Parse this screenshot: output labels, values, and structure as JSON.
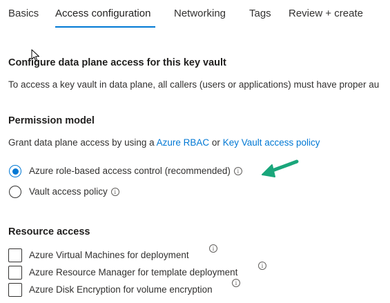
{
  "tabs": [
    {
      "label": "Basics"
    },
    {
      "label": "Access configuration"
    },
    {
      "label": "Networking"
    },
    {
      "label": "Tags"
    },
    {
      "label": "Review + create"
    }
  ],
  "active_tab": "Access configuration",
  "data_plane": {
    "heading": "Configure data plane access for this key vault",
    "description": "To access a key vault in data plane, all callers (users or applications) must have proper au"
  },
  "permission_model": {
    "heading": "Permission model",
    "grant_prefix": "Grant data plane access by using a ",
    "link_rbac": "Azure RBAC",
    "grant_or": " or ",
    "link_policy": "Key Vault access policy",
    "options": [
      {
        "label": "Azure role-based access control (recommended)",
        "checked": true
      },
      {
        "label": "Vault access policy",
        "checked": false
      }
    ]
  },
  "resource_access": {
    "heading": "Resource access",
    "items": [
      {
        "label": "Azure Virtual Machines for deployment",
        "checked": false
      },
      {
        "label": "Azure Resource Manager for template deployment",
        "checked": false
      },
      {
        "label": "Azure Disk Encryption for volume encryption",
        "checked": false
      }
    ]
  },
  "icons": {
    "info": "info-icon",
    "cursor": "mouse-cursor-icon",
    "arrow": "annotation-arrow-icon"
  },
  "colors": {
    "accent": "#0078d4",
    "arrow": "#1aa67b",
    "text": "#323130"
  }
}
